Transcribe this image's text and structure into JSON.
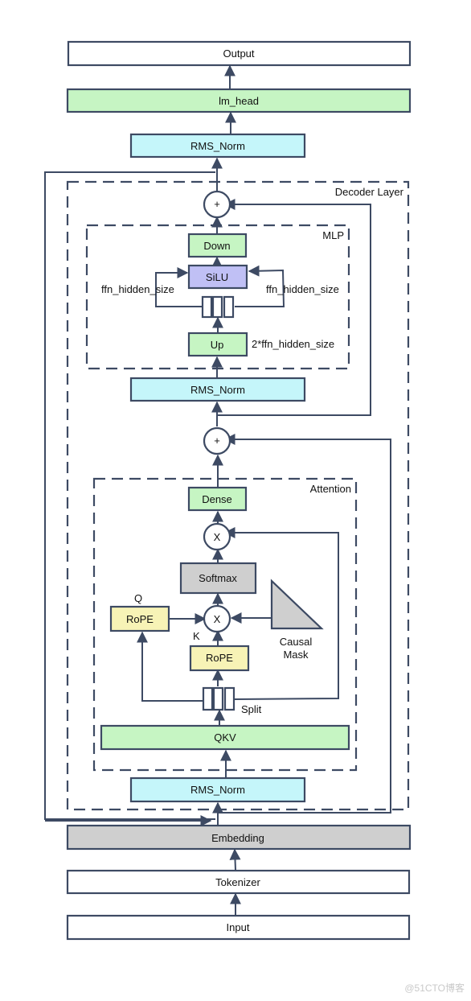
{
  "colors": {
    "stroke": "#3d4a63",
    "white": "#ffffff",
    "green": "#c6f5c3",
    "cyan": "#c5f6fa",
    "purple": "#c0c0f5",
    "gray": "#cfcfcf",
    "yellow": "#f7f3b6"
  },
  "blocks": {
    "output": "Output",
    "lm_head": "lm_head",
    "final_norm": "RMS_Norm",
    "down": "Down",
    "silu": "SiLU",
    "up": "Up",
    "post_attn_norm": "RMS_Norm",
    "dense": "Dense",
    "softmax": "Softmax",
    "rope_q": "RoPE",
    "rope_k": "RoPE",
    "qkv": "QKV",
    "input_norm": "RMS_Norm",
    "embedding": "Embedding",
    "tokenizer": "Tokenizer",
    "input": "Input"
  },
  "ops": {
    "add_top": "+",
    "add_mid": "+",
    "mul_top": "X",
    "mul_bottom": "X"
  },
  "labels": {
    "decoder_layer": "Decoder Layer",
    "mlp": "MLP",
    "attention": "Attention",
    "ffn_left": "ffn_hidden_size",
    "ffn_right": "ffn_hidden_size",
    "ffn_up": "2*ffn_hidden_size",
    "q": "Q",
    "k": "K",
    "causal_1": "Causal",
    "causal_2": "Mask",
    "split": "Split"
  },
  "watermark": "@51CTO博客"
}
